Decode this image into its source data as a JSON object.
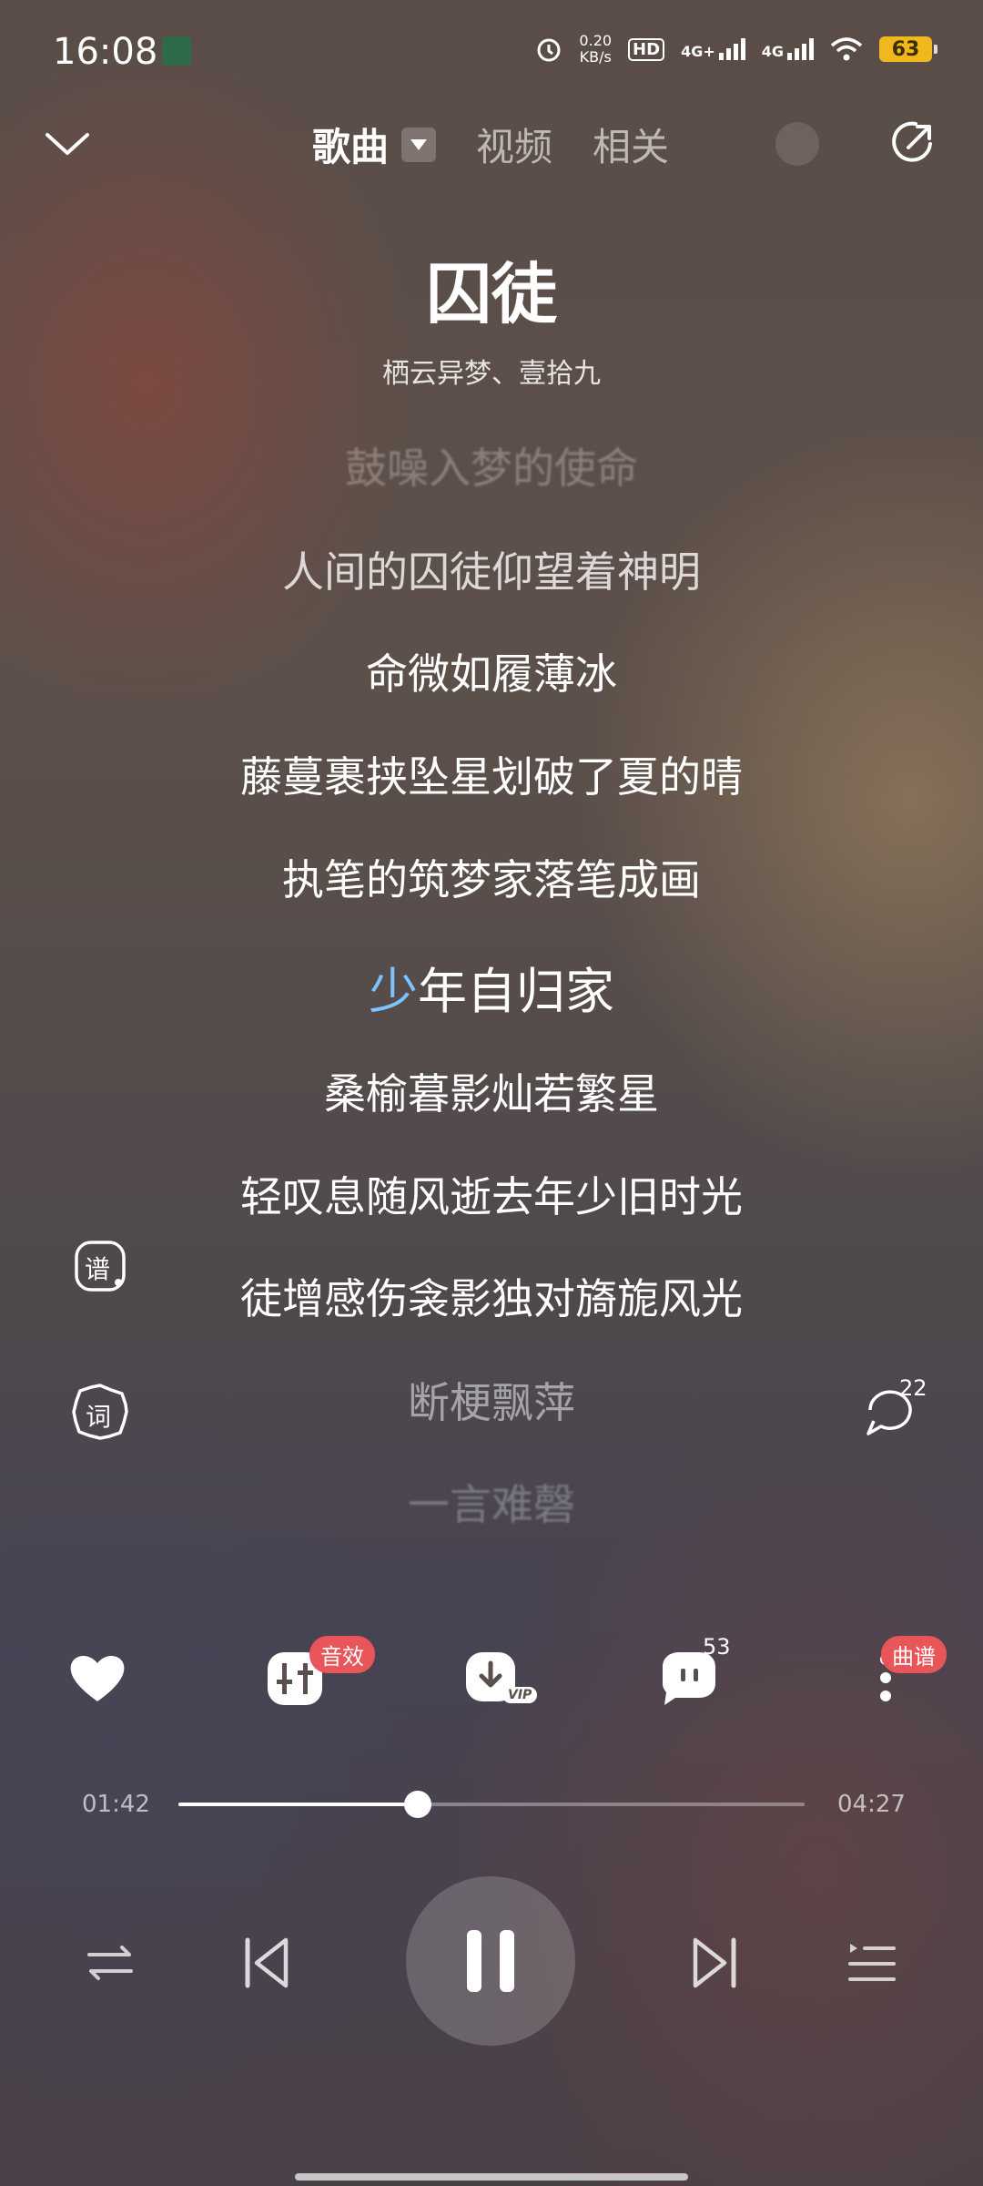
{
  "status_bar": {
    "time": "16:08",
    "net_speed_value": "0.20",
    "net_speed_unit": "KB/s",
    "hd_label": "HD",
    "sim1": "4G+",
    "sim2": "4G",
    "battery": "63"
  },
  "nav": {
    "tabs": [
      "歌曲",
      "视频",
      "相关"
    ],
    "active_tab": "歌曲"
  },
  "song": {
    "title": "囚徒",
    "artist": "栖云异梦、壹拾九"
  },
  "lyrics": {
    "lines": [
      "鼓噪入梦的使命",
      "人间的囚徒仰望着神明",
      "命微如履薄冰",
      "藤蔓裹挟坠星划破了夏的晴",
      "执笔的筑梦家落笔成画",
      "少年自归家",
      "桑榆暮影灿若繁星",
      "轻叹息随风逝去年少旧时光",
      "徒增感伤衾影独对旖旎风光",
      "断梗飘萍",
      "一言难磬"
    ],
    "current_highlight": "少",
    "current_rest": "年自归家"
  },
  "side_buttons": {
    "score_label": "谱",
    "lyric_label": "词",
    "comment_count": "22"
  },
  "actions": {
    "sound_effect_badge": "音效",
    "vip_label": "VIP",
    "comment_count": "53",
    "score_badge": "曲谱"
  },
  "progress": {
    "current": "01:42",
    "total": "04:27",
    "fraction": 0.382
  },
  "colors": {
    "lyric_highlight": "#7cc3ff",
    "badge": "#e8565a",
    "battery": "#f0b81d"
  }
}
